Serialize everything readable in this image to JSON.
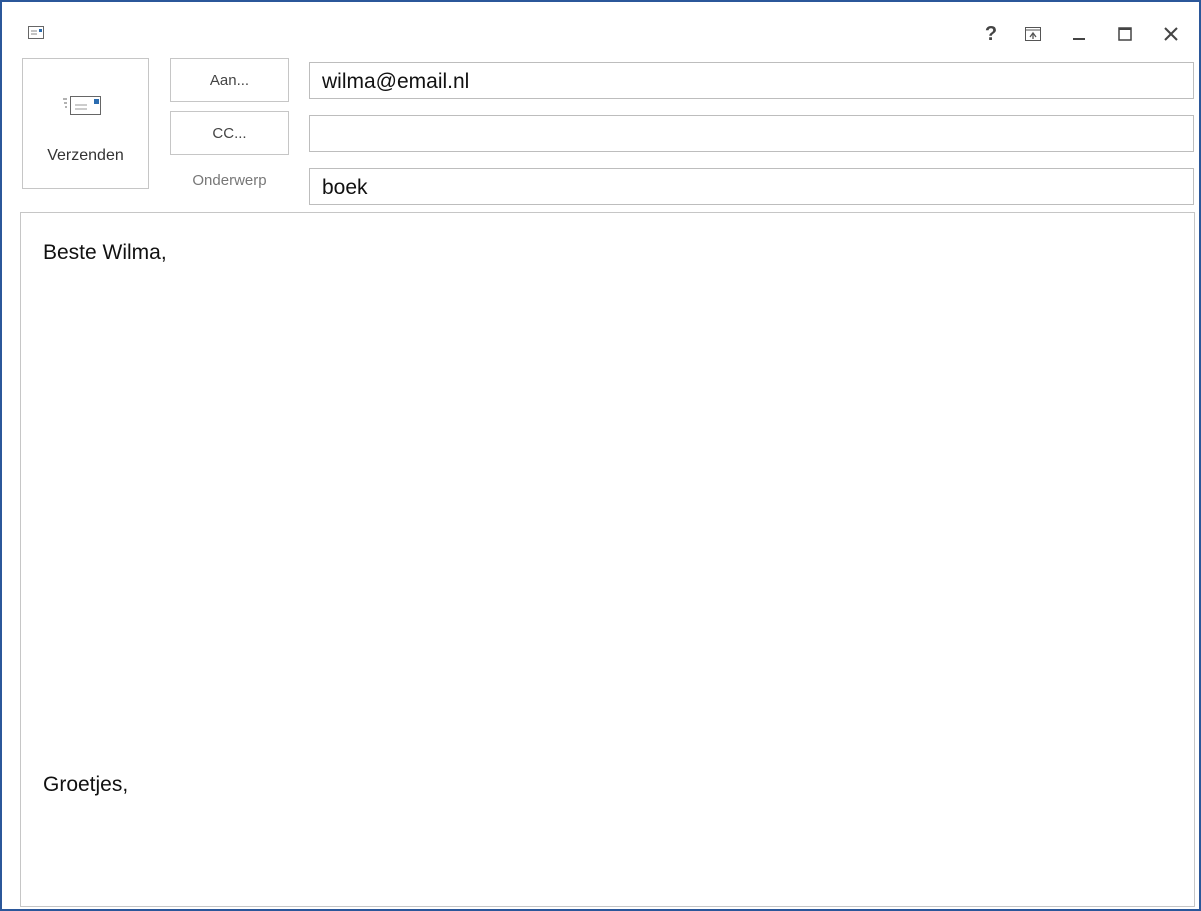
{
  "titlebar": {
    "app_icon": "mail-icon",
    "help_label": "?",
    "controls": [
      "help-icon",
      "ribbon-display-icon",
      "minimize-icon",
      "maximize-icon",
      "close-icon"
    ]
  },
  "send": {
    "label": "Verzenden",
    "icon": "send-mail-icon"
  },
  "fields": {
    "to_button": "Aan...",
    "to_value": "wilma@email.nl",
    "cc_button": "CC...",
    "cc_value": "",
    "subject_label": "Onderwerp",
    "subject_value": "boek"
  },
  "body": {
    "greeting": "Beste Wilma,",
    "closing": "Groetjes,"
  },
  "colors": {
    "window_border": "#2b579a",
    "icon_accent": "#2b6cb0"
  }
}
